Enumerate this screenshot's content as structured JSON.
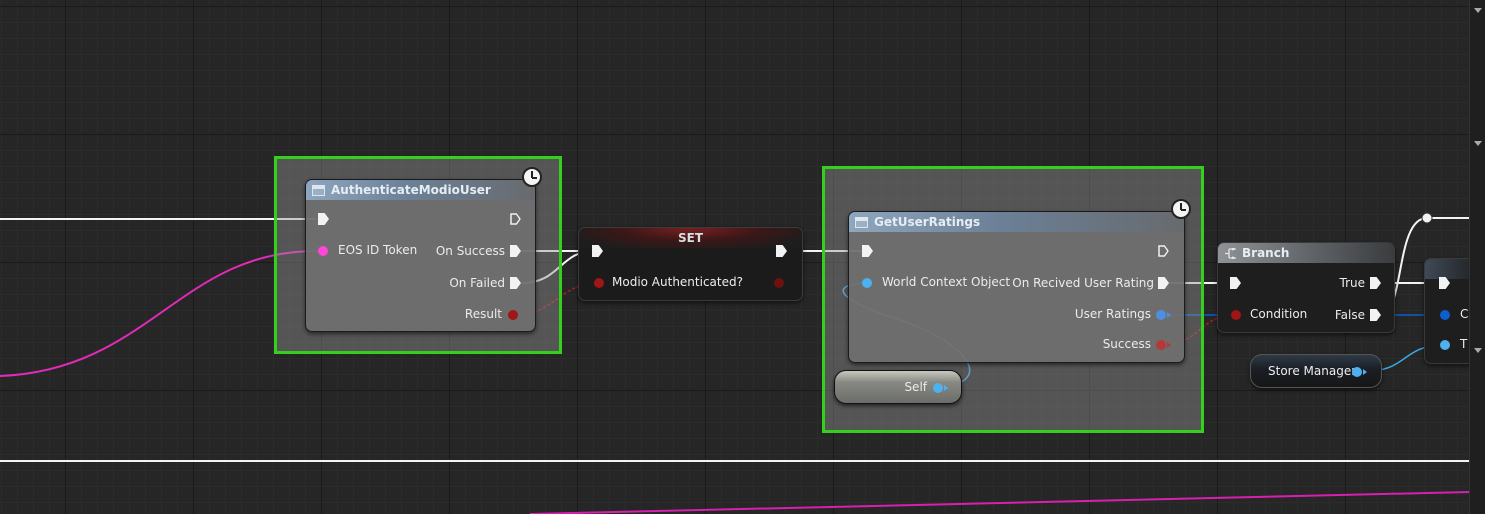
{
  "nodes": {
    "authenticate": {
      "title": "AuthenticateModioUser",
      "pins": {
        "eos_id_token": "EOS ID Token",
        "on_success": "On Success",
        "on_failed": "On Failed",
        "result": "Result"
      }
    },
    "set": {
      "title": "SET",
      "pins": {
        "modio_authenticated": "Modio Authenticated?"
      }
    },
    "get_user_ratings": {
      "title": "GetUserRatings",
      "pins": {
        "world_context_object": "World Context Object",
        "on_received_user_rating": "On Recived User Rating",
        "user_ratings": "User Ratings",
        "success": "Success"
      }
    },
    "self": {
      "label": "Self"
    },
    "branch": {
      "title": "Branch",
      "pins": {
        "condition": "Condition",
        "true": "True",
        "false": "False"
      }
    },
    "store_manager": {
      "label": "Store Manager"
    },
    "cutoff_node": {
      "pins": {
        "pin_c": "C",
        "pin_t": "T"
      }
    }
  },
  "colors": {
    "comment_border": "#33d11b",
    "exec_pin": "#f2f2f2",
    "string_pin": "#ff46d7",
    "bool_pin": "#a01616",
    "object_pin": "#4db1ef",
    "array_pin": "#0d5fcf"
  },
  "icons": [
    "function-icon",
    "clock-icon",
    "branch-icon",
    "exec-pin-icon",
    "chevron-down-icon"
  ]
}
